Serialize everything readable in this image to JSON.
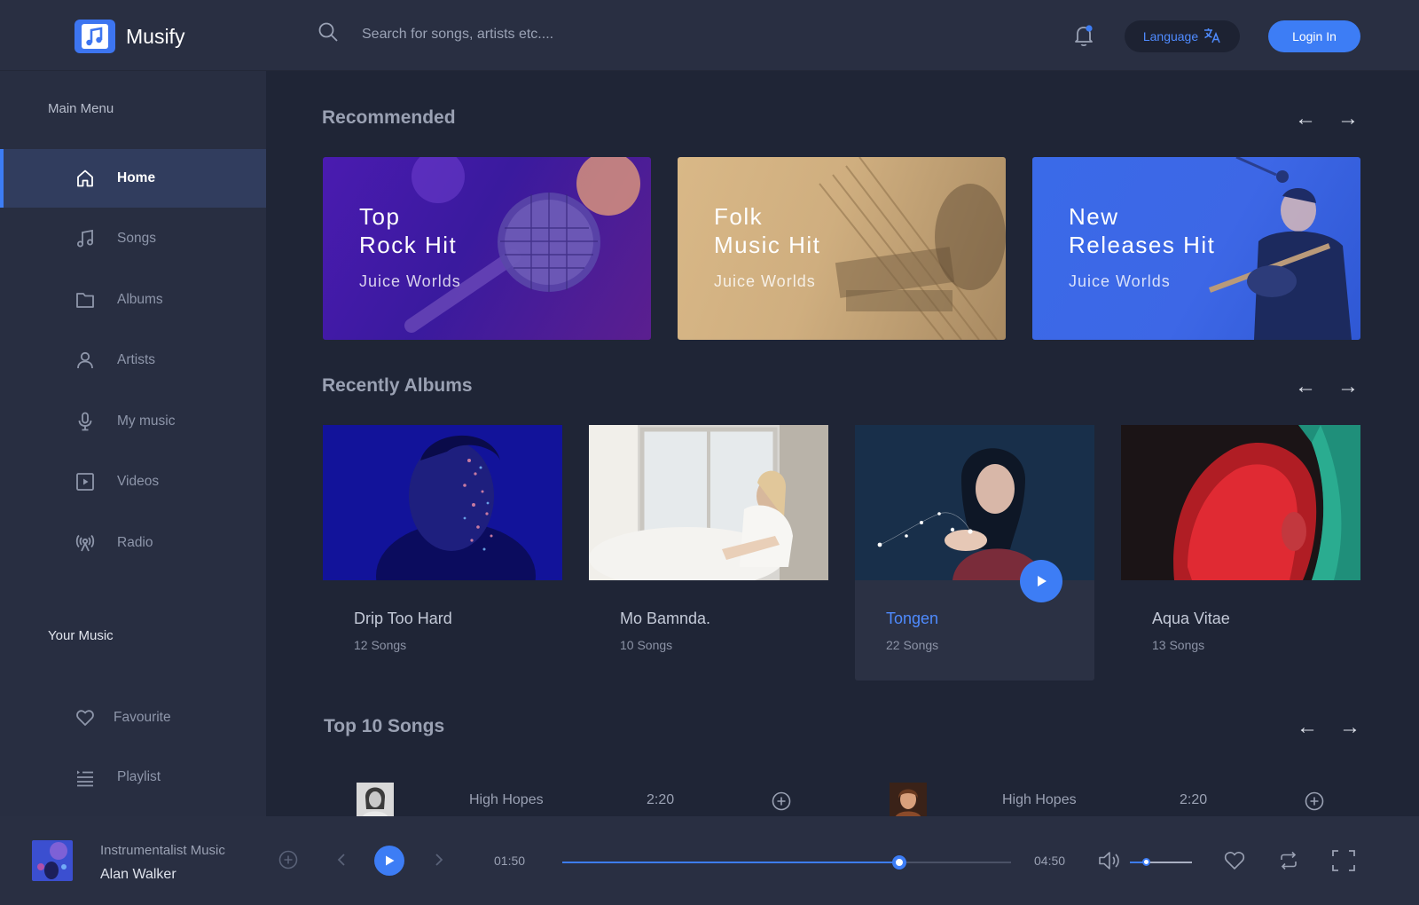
{
  "header": {
    "app_name": "Musify",
    "search_placeholder": "Search for songs, artists etc....",
    "language_label": "Language",
    "login_label": "Login In"
  },
  "sidebar": {
    "main_heading": "Main Menu",
    "items": [
      {
        "label": "Home",
        "icon": "home-icon",
        "active": true
      },
      {
        "label": "Songs",
        "icon": "music-note-icon"
      },
      {
        "label": "Albums",
        "icon": "folder-icon"
      },
      {
        "label": "Artists",
        "icon": "user-icon"
      },
      {
        "label": "My music",
        "icon": "microphone-icon"
      },
      {
        "label": "Videos",
        "icon": "video-icon"
      },
      {
        "label": "Radio",
        "icon": "radio-icon"
      }
    ],
    "your_music_heading": "Your Music",
    "your_music": [
      {
        "label": "Favourite",
        "icon": "heart-icon"
      },
      {
        "label": "Playlist",
        "icon": "playlist-icon"
      }
    ]
  },
  "recommended": {
    "title": "Recommended",
    "cards": [
      {
        "line1": "Top",
        "line2": "Rock Hit",
        "subtitle": "Juice Worlds"
      },
      {
        "line1": "Folk",
        "line2": "Music Hit",
        "subtitle": "Juice Worlds"
      },
      {
        "line1": "New",
        "line2": "Releases Hit",
        "subtitle": "Juice Worlds"
      }
    ]
  },
  "albums": {
    "title": "Recently Albums",
    "items": [
      {
        "name": "Drip Too Hard",
        "count": "12 Songs"
      },
      {
        "name": "Mo Bamnda.",
        "count": "10 Songs"
      },
      {
        "name": "Tongen",
        "count": "22 Songs",
        "active": true
      },
      {
        "name": "Aqua Vitae",
        "count": "13 Songs"
      }
    ]
  },
  "top_songs": {
    "title": "Top 10 Songs",
    "items": [
      {
        "name": "High Hopes",
        "duration": "2:20"
      },
      {
        "name": "High Hopes",
        "duration": "2:20"
      }
    ]
  },
  "player": {
    "title": "Instrumentalist Music",
    "artist": "Alan Walker",
    "current_time": "01:50",
    "total_time": "04:50",
    "progress": 0.75,
    "volume": 0.25
  },
  "colors": {
    "accent": "#3d7df5",
    "background": "#1f2536",
    "panel": "#292f42"
  }
}
